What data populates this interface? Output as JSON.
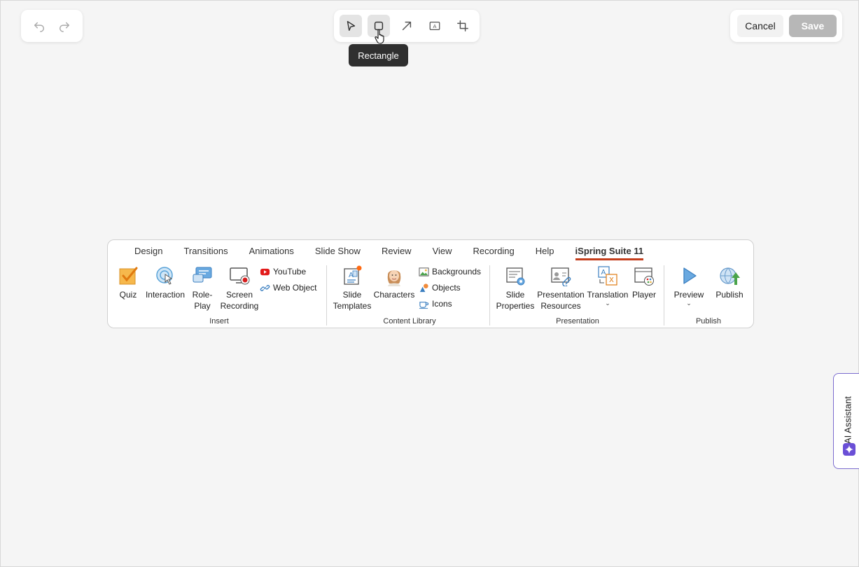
{
  "top_bar": {
    "history": {
      "undo_icon": "undo-icon",
      "redo_icon": "redo-icon"
    },
    "tools": {
      "items": [
        {
          "name": "select-tool",
          "icon": "cursor-arrow-icon",
          "active": false
        },
        {
          "name": "rectangle-tool",
          "icon": "rectangle-icon",
          "active": true
        },
        {
          "name": "arrow-tool",
          "icon": "arrow-icon",
          "active": false
        },
        {
          "name": "text-tool",
          "icon": "text-box-icon",
          "active": false
        },
        {
          "name": "crop-tool",
          "icon": "crop-icon",
          "active": false
        }
      ],
      "tooltip": "Rectangle"
    },
    "actions": {
      "cancel_label": "Cancel",
      "save_label": "Save"
    }
  },
  "ribbon": {
    "tabs": [
      "Design",
      "Transitions",
      "Animations",
      "Slide Show",
      "Review",
      "View",
      "Recording",
      "Help",
      "iSpring Suite 11"
    ],
    "active_tab": "iSpring Suite 11",
    "groups": {
      "insert": {
        "label": "Insert",
        "quiz": "Quiz",
        "interaction": "Interaction",
        "roleplay_1": "Role-",
        "roleplay_2": "Play",
        "screen_1": "Screen",
        "screen_2": "Recording",
        "youtube": "YouTube",
        "web_object": "Web Object"
      },
      "content_library": {
        "label": "Content Library",
        "slide_1": "Slide",
        "slide_2": "Templates",
        "characters": "Characters",
        "backgrounds": "Backgrounds",
        "objects": "Objects",
        "icons": "Icons"
      },
      "presentation": {
        "label": "Presentation",
        "props_1": "Slide",
        "props_2": "Properties",
        "res_1": "Presentation",
        "res_2": "Resources",
        "translation": "Translation",
        "player": "Player"
      },
      "publish": {
        "label": "Publish",
        "preview": "Preview",
        "publish": "Publish"
      }
    }
  },
  "ai_assistant": {
    "label": "AI Assistant"
  },
  "colors": {
    "accent_tab": "#c43e1c",
    "ai_purple": "#6a4fd6",
    "tooltip_bg": "#2f2f2f",
    "save_disabled": "#b7b7b7"
  }
}
